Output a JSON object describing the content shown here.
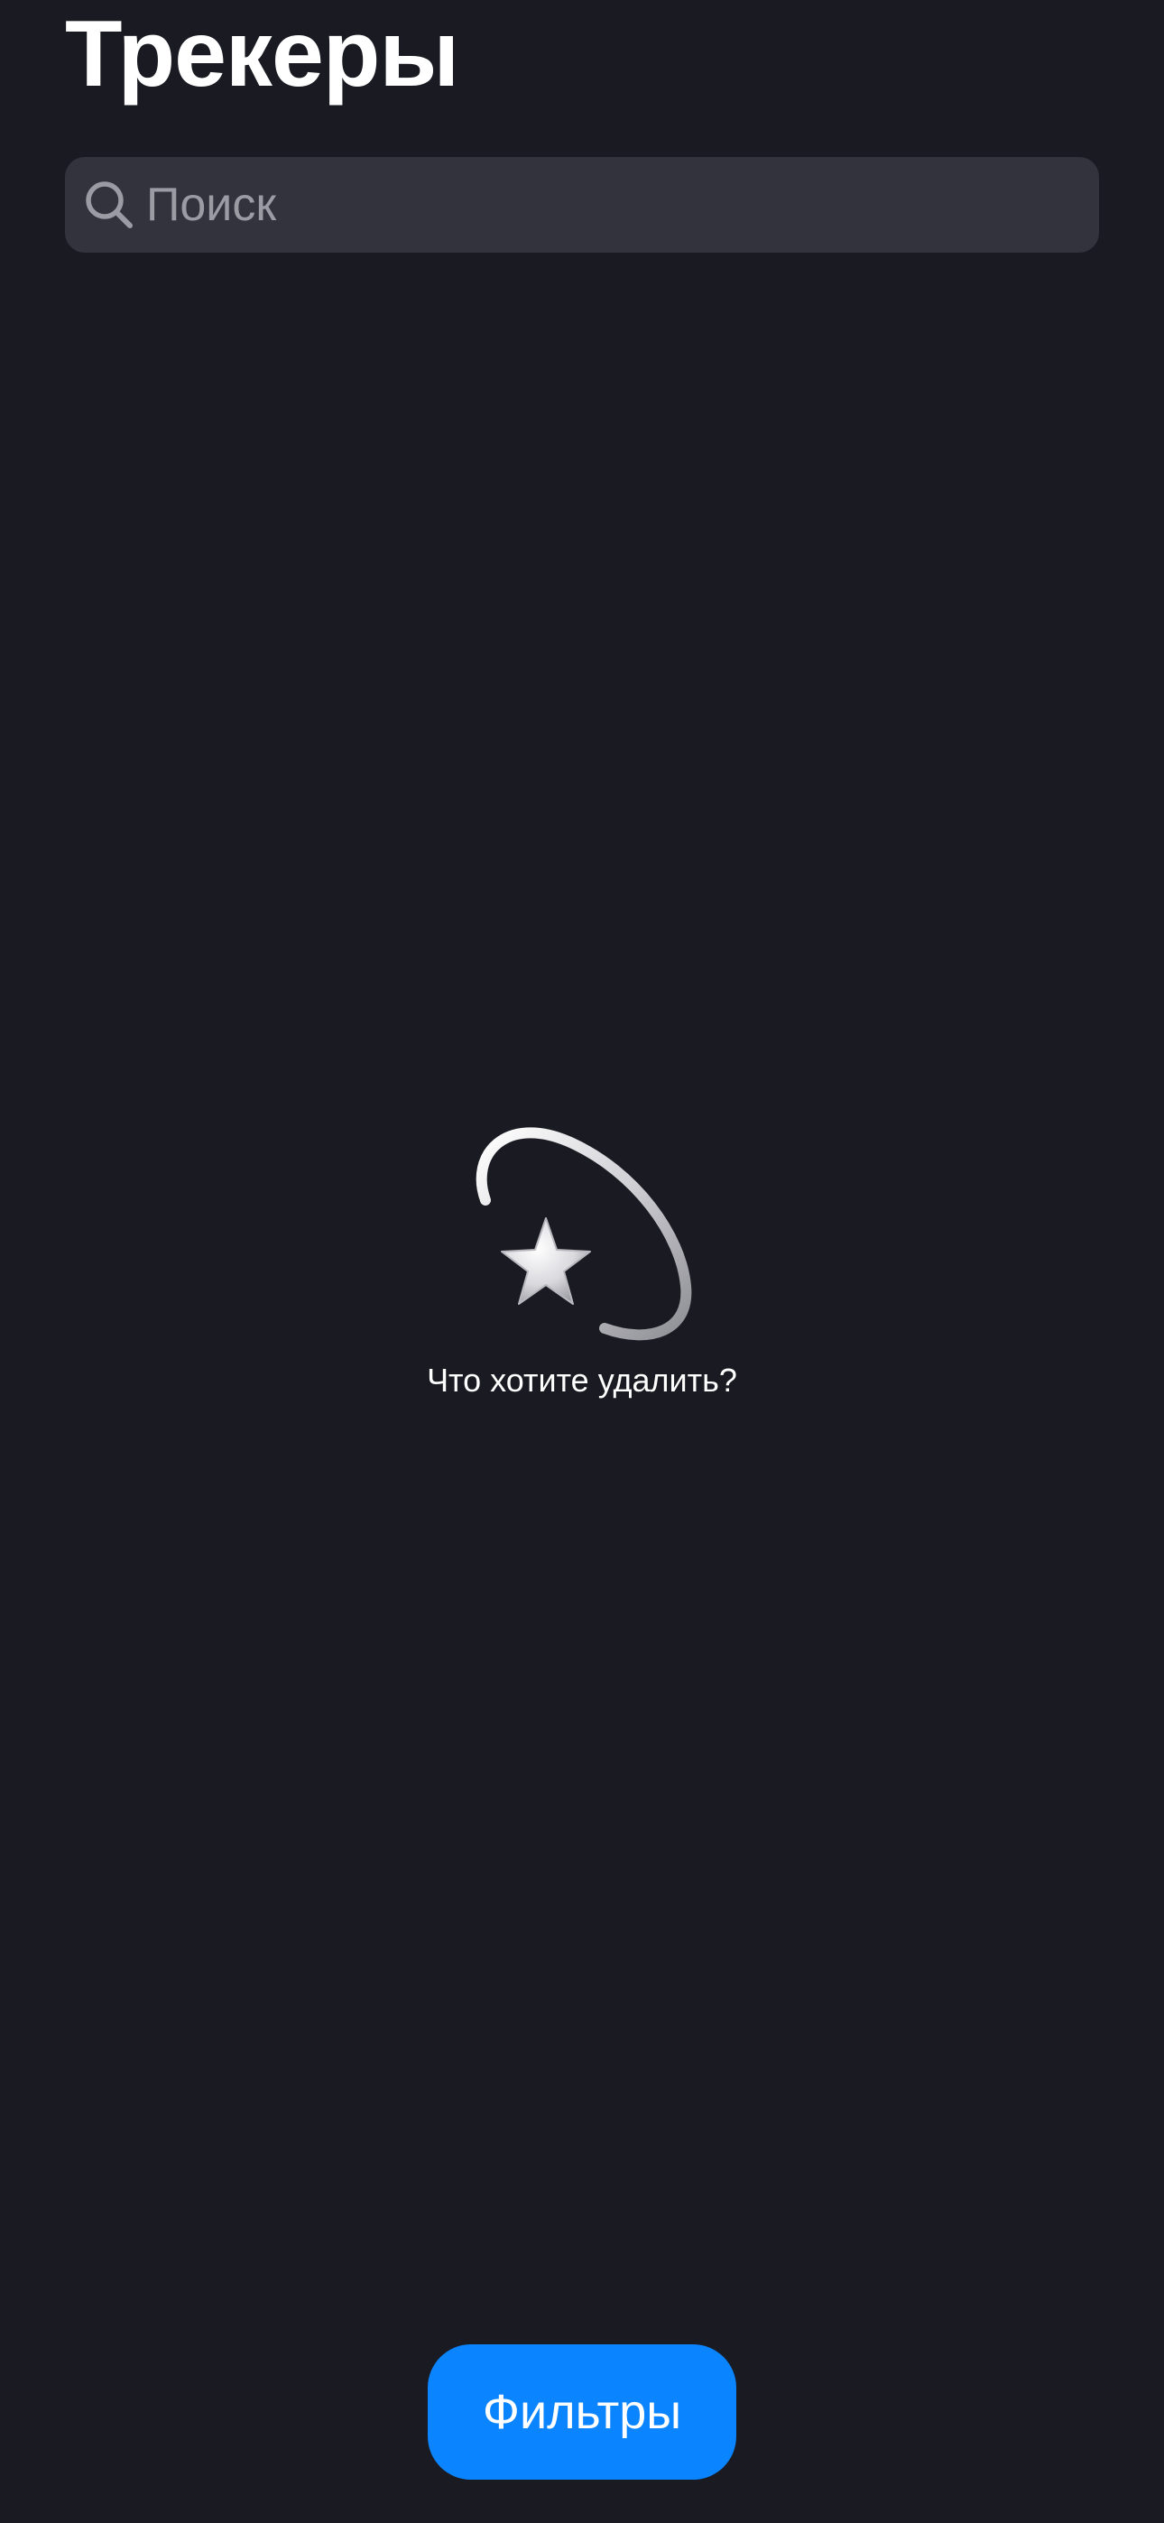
{
  "header": {
    "title": "Трекеры"
  },
  "search": {
    "placeholder": "Поиск",
    "icon": "search-icon"
  },
  "empty_state": {
    "icon": "dizzy-star-icon",
    "caption": "Что хотите удалить?"
  },
  "bottom": {
    "filters_label": "Фильтры"
  },
  "colors": {
    "background": "#1A1B22",
    "search_background": "#32333D",
    "placeholder": "#9A9BA3",
    "accent": "#0A84FF",
    "text": "#FFFFFF"
  }
}
